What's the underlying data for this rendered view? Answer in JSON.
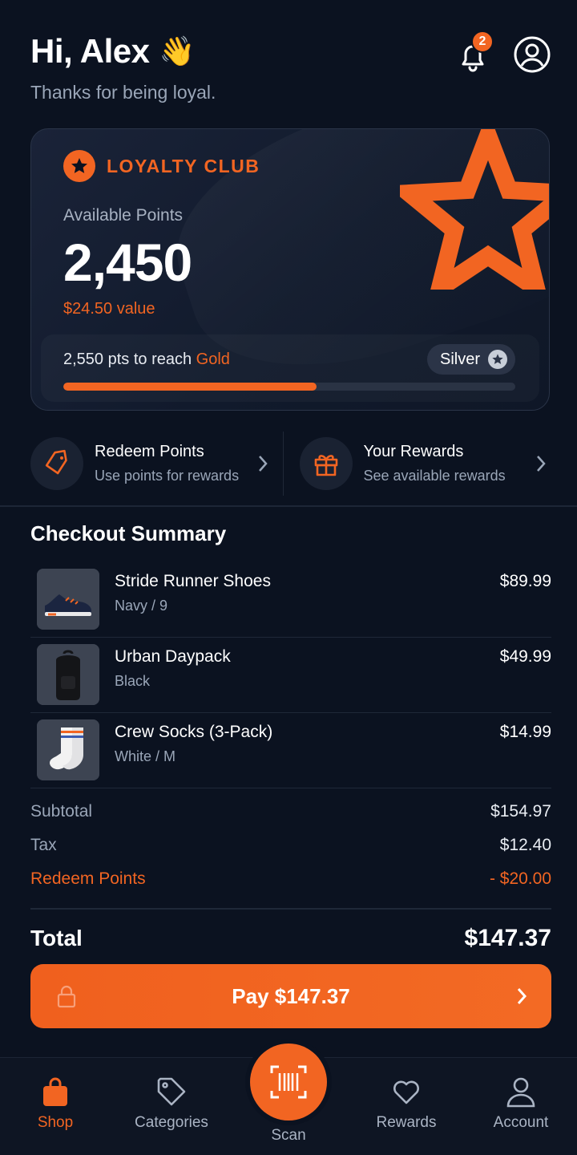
{
  "header": {
    "greeting": "Hi, Alex",
    "wave_emoji": "👋",
    "subtitle": "Thanks for being loyal.",
    "notification_count": "2",
    "icons": [
      "bell-icon",
      "account-icon"
    ]
  },
  "loyalty": {
    "club_label": "LOYALTY CLUB",
    "available_label": "Available Points",
    "points": "2,450",
    "value": "$24.50 value",
    "progress_prefix": "2,550 pts to reach ",
    "next_tier": "Gold",
    "current_tier": "Silver",
    "progress_fraction": 0.56
  },
  "quick_actions": [
    {
      "title": "Redeem Points",
      "subtitle": "Use points for rewards",
      "icon": "tag-icon"
    },
    {
      "title": "Your Rewards",
      "subtitle": "See available rewards",
      "icon": "gift-icon"
    }
  ],
  "checkout": {
    "title": "Checkout Summary",
    "items": [
      {
        "name": "Stride Runner Shoes",
        "variant": "Navy / 9",
        "price": "$89.99",
        "image": "shoe"
      },
      {
        "name": "Urban Daypack",
        "variant": "Black",
        "price": "$49.99",
        "image": "backpack"
      },
      {
        "name": "Crew Socks (3-Pack)",
        "variant": "White / M",
        "price": "$14.99",
        "image": "socks"
      }
    ],
    "subtotal_label": "Subtotal",
    "subtotal": "$154.97",
    "tax_label": "Tax",
    "tax": "$12.40",
    "redeem_label": "Redeem Points",
    "redeem": "- $20.00",
    "total_label": "Total",
    "total": "$147.37",
    "pay_label": "Pay $147.37"
  },
  "nav": {
    "items": [
      "Shop",
      "Categories",
      "Scan",
      "Rewards",
      "Account"
    ],
    "active": "Shop"
  },
  "colors": {
    "accent": "#f26522",
    "background": "#0b1220",
    "card": "#141d30"
  }
}
